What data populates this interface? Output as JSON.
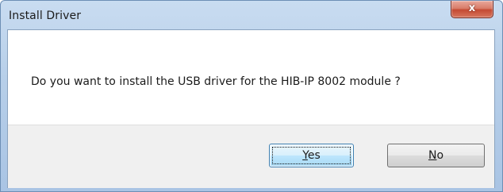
{
  "window": {
    "title": "Install Driver",
    "close_glyph": "x"
  },
  "message": "Do you want to install the USB driver for the HIB-IP 8002 module ?",
  "buttons": {
    "yes": {
      "mnemonic": "Y",
      "rest": "es"
    },
    "no": {
      "mnemonic": "N",
      "rest": "o"
    }
  },
  "colors": {
    "titlebar": "#b7cfe9",
    "close_button": "#c44a33",
    "default_button": "#bee6fd",
    "button_area": "#f0f0f0"
  },
  "icons": {
    "close": "close-icon"
  }
}
